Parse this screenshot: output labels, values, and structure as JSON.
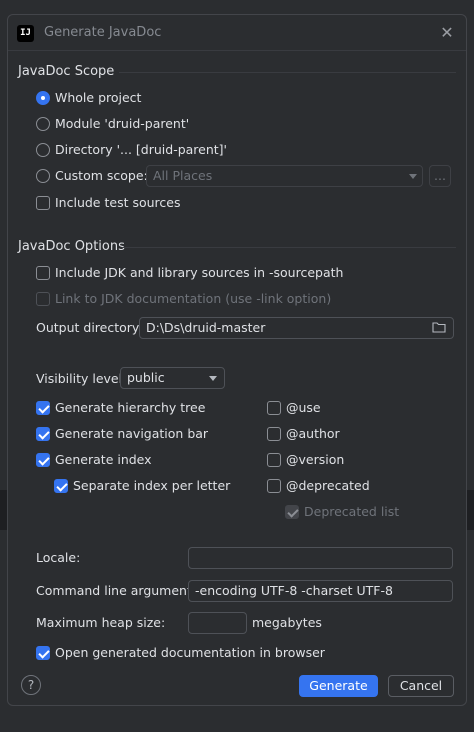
{
  "window": {
    "title": "Generate JavaDoc",
    "app_icon": "IJ"
  },
  "scope": {
    "title": "JavaDoc Scope",
    "options": [
      "Whole project",
      "Module 'druid-parent'",
      "Directory '... [druid-parent]'",
      "Custom scope:"
    ],
    "selected": "Whole project",
    "custom_scope_value": "All Places",
    "ellipsis": "...",
    "include_test_sources": "Include test sources"
  },
  "options": {
    "title": "JavaDoc Options",
    "include_jdk": "Include JDK and library sources in -sourcepath",
    "link_jdk": "Link to JDK documentation (use -link option)",
    "output_label": "Output directory:",
    "output_value": "D:\\Ds\\druid-master",
    "visibility_label": "Visibility level:",
    "visibility_value": "public",
    "left_checks": [
      "Generate hierarchy tree",
      "Generate navigation bar",
      "Generate index",
      "Separate index per letter"
    ],
    "right_checks": [
      "@use",
      "@author",
      "@version",
      "@deprecated"
    ],
    "deprecated_list": "Deprecated list"
  },
  "bottom": {
    "locale_label": "Locale:",
    "locale_value": "",
    "cmd_label": "Command line arguments:",
    "cmd_value": "-encoding UTF-8 -charset UTF-8",
    "heap_label": "Maximum heap size:",
    "heap_value": "",
    "heap_unit": "megabytes",
    "open_browser": "Open generated documentation in browser"
  },
  "buttons": {
    "help": "?",
    "generate": "Generate",
    "cancel": "Cancel"
  },
  "colors": {
    "accent": "#3574f0",
    "background": "#2b2d30",
    "text": "#dfe1e5"
  }
}
